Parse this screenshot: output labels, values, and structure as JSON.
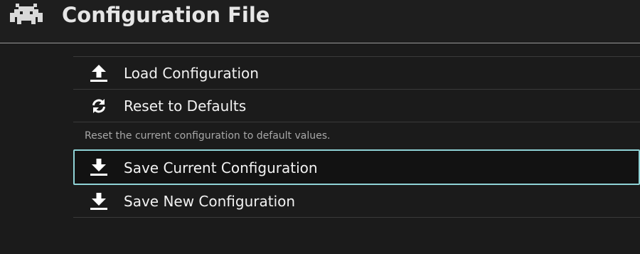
{
  "header": {
    "title": "Configuration File",
    "logo_icon": "retroarch-invader-icon"
  },
  "menu": {
    "items": [
      {
        "label": "Load Configuration",
        "icon": "upload-icon"
      },
      {
        "label": "Reset to Defaults",
        "icon": "refresh-icon",
        "sublabel": "Reset the current configuration to default values."
      },
      {
        "label": "Save Current Configuration",
        "icon": "download-icon",
        "selected": true
      },
      {
        "label": "Save New Configuration",
        "icon": "download-icon"
      }
    ]
  },
  "colors": {
    "background": "#1b1b1b",
    "selection_border": "#8fd3d6",
    "text": "#f2f2f2",
    "sublabel_text": "#a8a8a8"
  }
}
